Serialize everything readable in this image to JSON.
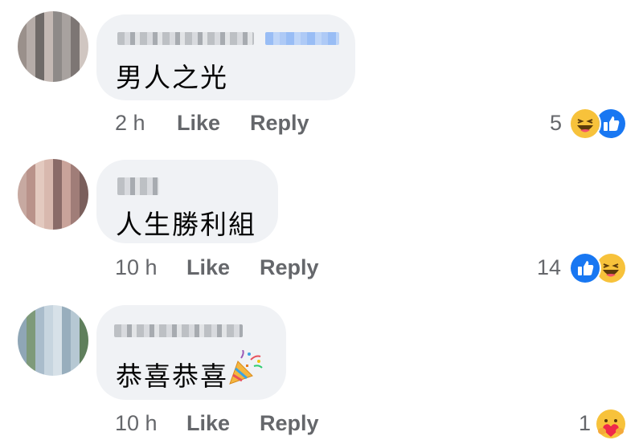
{
  "comments": [
    {
      "text": "男人之光",
      "time": "2 h",
      "like_label": "Like",
      "reply_label": "Reply",
      "reaction_count": "5",
      "reactions": [
        "haha-icon",
        "like-icon"
      ]
    },
    {
      "text": "人生勝利組",
      "time": "10 h",
      "like_label": "Like",
      "reply_label": "Reply",
      "reaction_count": "14",
      "reactions": [
        "like-icon",
        "haha-icon"
      ]
    },
    {
      "text": "恭喜恭喜",
      "time": "10 h",
      "like_label": "Like",
      "reply_label": "Reply",
      "reaction_count": "1",
      "reactions": [
        "care-icon"
      ],
      "emoji": "party-popper-icon"
    }
  ],
  "colors": {
    "bubble": "#f0f2f5",
    "meta_text": "#65676b",
    "like_blue": "#1877f2",
    "haha_yellow": "#f7c23b"
  }
}
